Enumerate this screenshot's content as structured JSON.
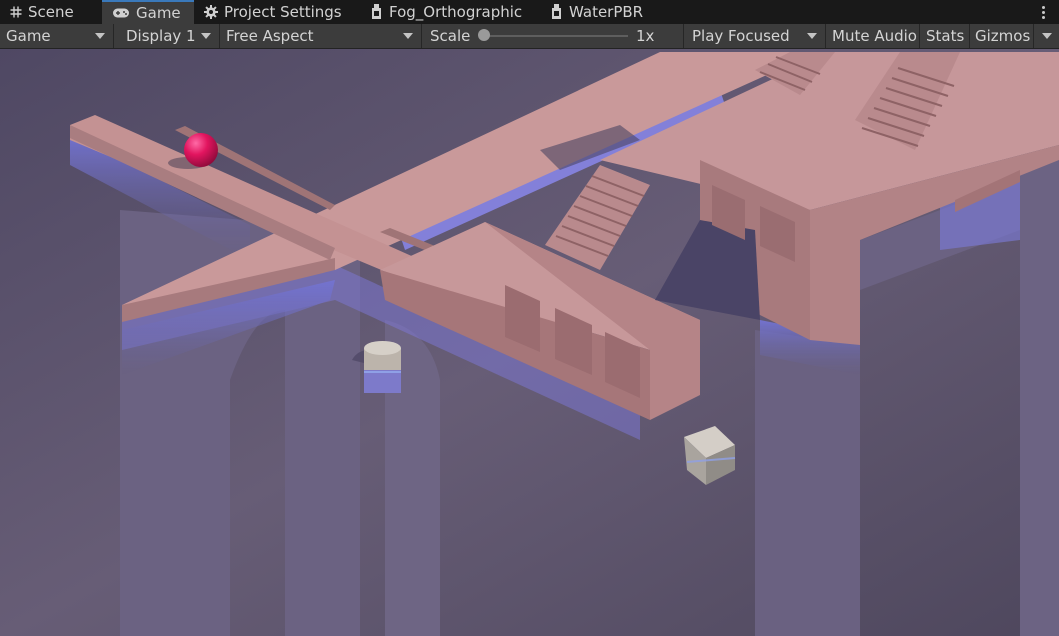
{
  "tabs": [
    {
      "label": "Scene",
      "icon": "grid-hash-icon",
      "active": false
    },
    {
      "label": "Game",
      "icon": "gamepad-icon",
      "active": true
    },
    {
      "label": "Project Settings",
      "icon": "gear-icon",
      "active": false
    },
    {
      "label": "Fog_Orthographic",
      "icon": "prefab-variant-icon",
      "active": false
    },
    {
      "label": "WaterPBR",
      "icon": "prefab-variant-icon",
      "active": false
    }
  ],
  "more_menu_icon": "vertical-ellipsis-icon",
  "toolbar": {
    "mode": "Game",
    "display": "Display 1",
    "aspect": "Free Aspect",
    "scale_label": "Scale",
    "scale_value": "1x",
    "scale_level": 0,
    "play_mode": "Play Focused",
    "mute_audio": "Mute Audio",
    "stats": "Stats",
    "gizmos": "Gizmos"
  },
  "scene": {
    "background_color": "#5f566e",
    "stone_color": "#c08c8c",
    "water_color": "#7a7ad6",
    "ball_color": "#e2155f",
    "objects": [
      "walkway",
      "pink-ball",
      "water-channel",
      "staircase",
      "arch-pillar",
      "cylinder-post",
      "floating-cube"
    ]
  },
  "colors": {
    "tab_active_accent": "#3a79bb",
    "panel_bg": "#3c3c3c",
    "tabbar_bg": "#191919"
  }
}
